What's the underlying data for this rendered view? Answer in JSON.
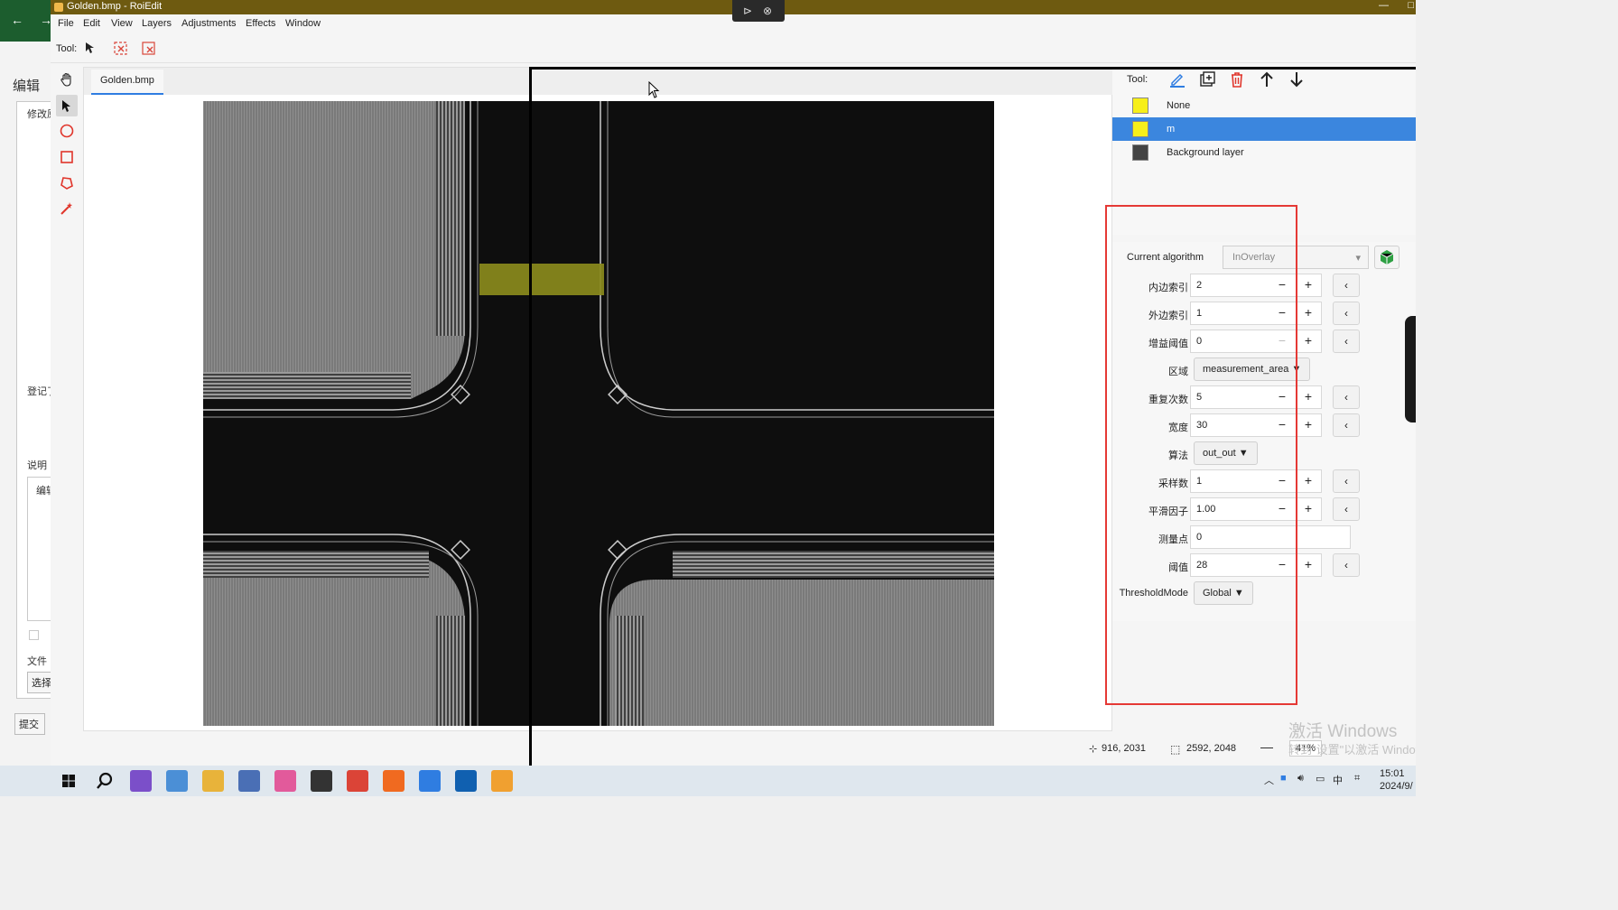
{
  "background_window": {
    "title": "编辑",
    "label_modify": "修改原",
    "label_register": "登记了",
    "label_desc": "说明",
    "tab_edit": "编辑",
    "label_file": "文件",
    "btn_choose": "选择",
    "btn_submit": "提交"
  },
  "window": {
    "title": "Golden.bmp - RoiEdit",
    "minimize": "—",
    "close": "□"
  },
  "menu": [
    "File",
    "Edit",
    "View",
    "Layers",
    "Adjustments",
    "Effects",
    "Window"
  ],
  "toolbar": {
    "label": "Tool:"
  },
  "document_tab": "Golden.bmp",
  "left_tools": [
    "hand-icon",
    "pointer-icon",
    "circle-icon",
    "rectangle-icon",
    "polygon-icon",
    "magic-wand-icon"
  ],
  "layers_panel": {
    "tool_label": "Tool:",
    "layers": [
      {
        "name": "None",
        "color": "#f7ef1a",
        "selected": false
      },
      {
        "name": "m",
        "color": "#f7ef1a",
        "selected": true
      },
      {
        "name": "Background layer",
        "color": "#444444",
        "selected": false
      }
    ]
  },
  "properties": {
    "current_algorithm_label": "Current algorithm",
    "current_algorithm": "InOverlay",
    "rows": [
      {
        "label": "内边索引",
        "type": "num",
        "value": "2"
      },
      {
        "label": "外边索引",
        "type": "num",
        "value": "1"
      },
      {
        "label": "增益阈值",
        "type": "num",
        "value": "0",
        "minus_disabled": true
      },
      {
        "label": "区域",
        "type": "dropdown",
        "value": "measurement_area"
      },
      {
        "label": "重复次数",
        "type": "num",
        "value": "5"
      },
      {
        "label": "宽度",
        "type": "num",
        "value": "30"
      },
      {
        "label": "算法",
        "type": "dropdown",
        "value": "out_out"
      },
      {
        "label": "采样数",
        "type": "num",
        "value": "1"
      },
      {
        "label": "平滑因子",
        "type": "num",
        "value": "1.00"
      },
      {
        "label": "测量点",
        "type": "text",
        "value": "0"
      },
      {
        "label": "阈值",
        "type": "num",
        "value": "28"
      },
      {
        "label": "ThresholdMode",
        "type": "dropdown",
        "value": "Global"
      }
    ]
  },
  "status": {
    "cursor_pos": "916, 2031",
    "image_size": "2592, 2048",
    "zoom": "41%"
  },
  "watermark": {
    "line1": "激活 Windows",
    "line2": "转到\"设置\"以激活 Windows"
  },
  "taskbar": {
    "time": "15:01",
    "date": "2024/9/",
    "ime": "中",
    "apps": [
      "windows-start-icon",
      "search-icon",
      "visual-studio-icon",
      "photos-icon",
      "file-explorer-icon",
      "notepad-icon",
      "slack-icon",
      "msg-icon",
      "chrome-icon",
      "unity-icon",
      "tool-icon",
      "vs-icon",
      "roiedit-icon"
    ]
  },
  "colors": {
    "title_bar": "#6e5a10",
    "selection": "#3b86de",
    "highlight_box": "#e53935",
    "overlay_yellow": "#8a8a1c"
  }
}
